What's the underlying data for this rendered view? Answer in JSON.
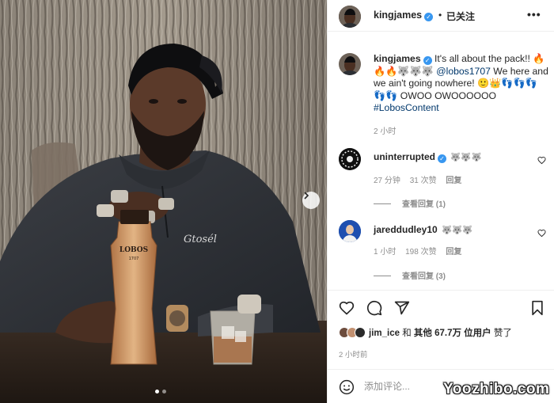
{
  "colors": {
    "link": "#00376b",
    "verified": "#3897f0",
    "muted": "#8e8e8e",
    "text": "#262626",
    "border": "#efefef"
  },
  "photo": {
    "bottle_brand": "LOBOS",
    "bottle_small": "1707",
    "hoodie_logo": "Gtosél",
    "carousel": {
      "next_icon": "chevron-right-icon",
      "dot_count": 2,
      "active_index": 0
    }
  },
  "header": {
    "username": "kingjames",
    "separator": "•",
    "follow_status": "已关注",
    "more_icon": "more-options-icon"
  },
  "caption": {
    "username": "kingjames",
    "text_part1": "It's all about the pack!! 🔥🔥🔥🐺🐺🐺",
    "mention": "@lobos1707",
    "text_part2": "We here and we ain't going nowhere! 🙂👑👣👣👣👣👣 OWOO OWOOOOOO",
    "hashtag": "#LobosContent",
    "time": "2 小时"
  },
  "comments": [
    {
      "username": "uninterrupted",
      "text": "🐺🐺🐺",
      "time": "27 分钟",
      "likes": "31 次赞",
      "reply_label": "回复",
      "view_replies": "查看回复 (1)"
    },
    {
      "username": "jareddudley10",
      "text": "🐺🐺🐺",
      "time": "1 小时",
      "likes": "198 次赞",
      "reply_label": "回复",
      "view_replies": "查看回复 (3)"
    }
  ],
  "actions": {
    "like_icon": "heart-icon",
    "comment_icon": "comment-icon",
    "share_icon": "share-icon",
    "save_icon": "bookmark-icon"
  },
  "likes": {
    "first_user": "jim_ice",
    "connector": "和",
    "others": "其他 67.7万 位用户",
    "suffix": "赞了"
  },
  "post_time": "2 小时前",
  "add_comment": {
    "emoji_icon": "emoji-icon",
    "placeholder": "添加评论..."
  },
  "watermark": "Yoozhibo.com"
}
